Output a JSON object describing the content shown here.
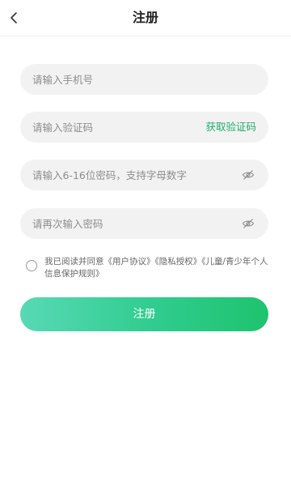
{
  "header": {
    "title": "注册",
    "back_icon": "chevron-left-icon"
  },
  "form": {
    "phone": {
      "placeholder": "请输入手机号",
      "value": ""
    },
    "code": {
      "placeholder": "请输入验证码",
      "value": "",
      "get_code_label": "获取验证码"
    },
    "password": {
      "placeholder": "请输入6-16位密码，支持字母数字",
      "value": "",
      "toggle_icon": "eye-closed-icon"
    },
    "confirm_password": {
      "placeholder": "请再次输入密码",
      "value": "",
      "toggle_icon": "eye-closed-icon"
    }
  },
  "agreement": {
    "checked": false,
    "prefix": "我已阅读并同意",
    "links": [
      "《用户协议》",
      "《隐私授权》",
      "《儿童/青少年个人信息保护规则》"
    ]
  },
  "submit_label": "注册",
  "colors": {
    "accent": "#1fae6d",
    "button_gradient_start": "#58d9b5",
    "button_gradient_end": "#1ec36d",
    "field_bg": "#f2f2f2"
  }
}
